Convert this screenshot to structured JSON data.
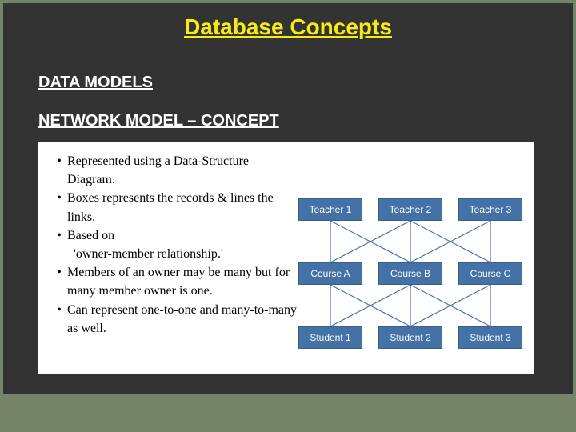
{
  "title": "Database Concepts",
  "sub1": "DATA MODELS",
  "sub2": "NETWORK MODEL – CONCEPT",
  "bullets": {
    "b1": "Represented using a Data-Structure Diagram.",
    "b2": "Boxes represents the records & lines the links.",
    "b3": "Based on",
    "b3b": "'owner-member relationship.'",
    "b4": "Members of an owner may be many but for many member owner is one.",
    "b5": "Can represent one-to-one and many-to-many as well."
  },
  "nodes": {
    "t1": "Teacher 1",
    "t2": "Teacher 2",
    "t3": "Teacher 3",
    "c1": "Course A",
    "c2": "Course B",
    "c3": "Course C",
    "s1": "Student 1",
    "s2": "Student 2",
    "s3": "Student 3"
  }
}
